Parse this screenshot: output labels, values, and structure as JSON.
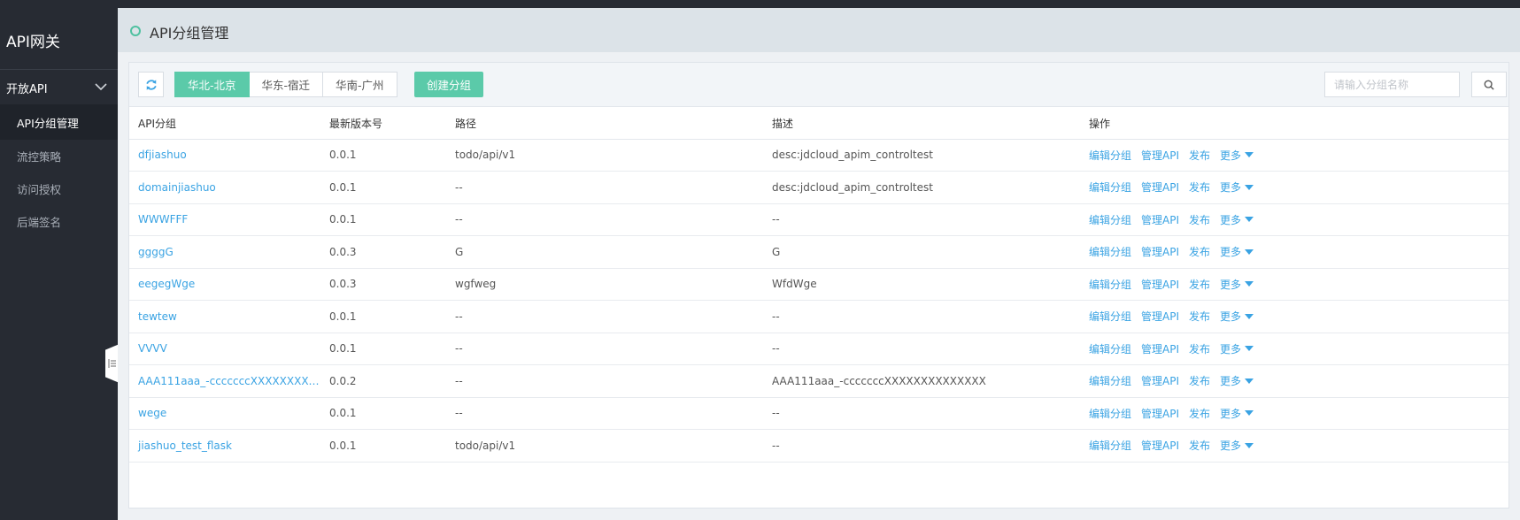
{
  "sidebar": {
    "brand": "API网关",
    "group": {
      "label": "开放API"
    },
    "items": [
      {
        "label": "API分组管理",
        "active": true
      },
      {
        "label": "流控策略",
        "active": false
      },
      {
        "label": "访问授权",
        "active": false
      },
      {
        "label": "后端签名",
        "active": false
      }
    ]
  },
  "header": {
    "title": "API分组管理"
  },
  "toolbar": {
    "regions": [
      "华北-北京",
      "华东-宿迁",
      "华南-广州"
    ],
    "active_region": "华北-北京",
    "create_label": "创建分组",
    "search_placeholder": "请输入分组名称",
    "search_value": ""
  },
  "table": {
    "columns": [
      "API分组",
      "最新版本号",
      "路径",
      "描述",
      "操作"
    ],
    "actions": {
      "edit": "编辑分组",
      "manage": "管理API",
      "publish": "发布",
      "more": "更多"
    },
    "rows": [
      {
        "name": "dfjiashuo",
        "version": "0.0.1",
        "path": "todo/api/v1",
        "desc": "desc:jdcloud_apim_controltest"
      },
      {
        "name": "domainjiashuo",
        "version": "0.0.1",
        "path": "--",
        "desc": "desc:jdcloud_apim_controltest"
      },
      {
        "name": "WWWFFF",
        "version": "0.0.1",
        "path": "--",
        "desc": "--"
      },
      {
        "name": "ggggG",
        "version": "0.0.3",
        "path": "G",
        "desc": "G"
      },
      {
        "name": "eegegWge",
        "version": "0.0.3",
        "path": "wgfweg",
        "desc": "WfdWge"
      },
      {
        "name": "tewtew",
        "version": "0.0.1",
        "path": "--",
        "desc": "--"
      },
      {
        "name": "VVVV",
        "version": "0.0.1",
        "path": "--",
        "desc": "--"
      },
      {
        "name": "AAA111aaa_-ccccccсXXXXXXXXXX...",
        "version": "0.0.2",
        "path": "--",
        "desc": "AAA111aaa_-ccccccсXXXXXXXXXXXXXX"
      },
      {
        "name": "wege",
        "version": "0.0.1",
        "path": "--",
        "desc": "--"
      },
      {
        "name": "jiashuo_test_flask",
        "version": "0.0.1",
        "path": "todo/api/v1",
        "desc": "--"
      }
    ]
  },
  "colors": {
    "accent": "#5bcaa9",
    "link": "#3aa3e3",
    "sidebar_bg": "#272b33"
  }
}
